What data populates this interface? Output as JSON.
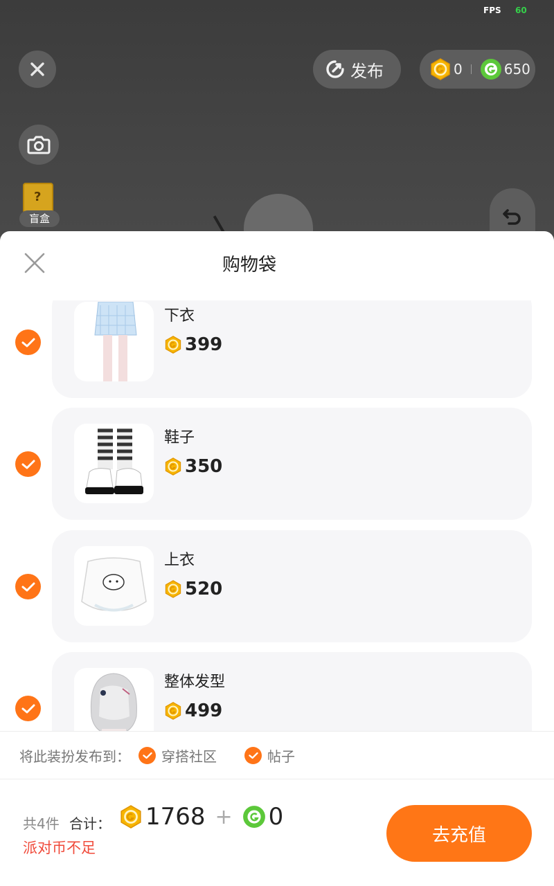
{
  "top": {
    "fps_label": "FPS",
    "fps_value": "60",
    "publish_label": "发布",
    "gold_balance": "0",
    "green_balance": "650",
    "blindbox_label": "盲盒"
  },
  "sheet": {
    "title": "购物袋",
    "items": [
      {
        "name": "下衣",
        "price": "399",
        "icon": "skirt-thumbnail",
        "checked": true
      },
      {
        "name": "鞋子",
        "price": "350",
        "icon": "boots-thumbnail",
        "checked": true
      },
      {
        "name": "上衣",
        "price": "520",
        "icon": "top-thumbnail",
        "checked": true
      },
      {
        "name": "整体发型",
        "price": "499",
        "icon": "hair-thumbnail",
        "checked": true
      }
    ],
    "publish_to": {
      "label": "将此装扮发布到：",
      "options": [
        {
          "label": "穿搭社区",
          "checked": true
        },
        {
          "label": "帖子",
          "checked": true
        }
      ]
    },
    "footer": {
      "count": "共4件",
      "total_label": "合计：",
      "gold_total": "1768",
      "plus": "+",
      "green_total": "0",
      "warning": "派对币不足",
      "recharge_label": "去充值"
    }
  },
  "colors": {
    "accent": "#ff7616",
    "warning": "#f04a3a",
    "card_bg": "#f6f6f8",
    "gold_coin": "#f7b500",
    "green_coin": "#5cc83a"
  }
}
